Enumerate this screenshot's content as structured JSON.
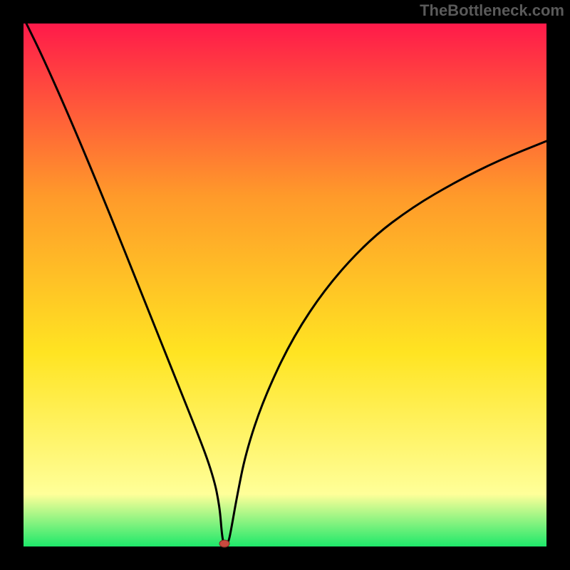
{
  "watermark": "TheBottleneck.com",
  "chart_data": {
    "type": "line",
    "title": "",
    "xlabel": "",
    "ylabel": "",
    "xlim": [
      33,
      767
    ],
    "ylim": [
      33,
      767
    ],
    "series": [
      {
        "name": "bottleneck-curve",
        "points": [
          [
            37,
            33
          ],
          [
            60,
            80
          ],
          [
            100,
            170
          ],
          [
            150,
            290
          ],
          [
            200,
            415
          ],
          [
            250,
            540
          ],
          [
            280,
            615
          ],
          [
            293,
            650
          ],
          [
            302,
            680
          ],
          [
            306,
            700
          ],
          [
            309,
            720
          ],
          [
            311,
            745
          ],
          [
            313,
            760
          ],
          [
            315,
            763
          ],
          [
            318,
            763
          ],
          [
            321,
            760
          ],
          [
            325,
            740
          ],
          [
            332,
            700
          ],
          [
            345,
            635
          ],
          [
            370,
            560
          ],
          [
            410,
            475
          ],
          [
            460,
            400
          ],
          [
            520,
            335
          ],
          [
            580,
            290
          ],
          [
            640,
            255
          ],
          [
            700,
            225
          ],
          [
            767,
            198
          ]
        ]
      }
    ],
    "marker": {
      "x": 315,
      "y": 763,
      "color": "#c94a3f"
    },
    "background_gradient": {
      "top": "#ff1a4a",
      "mid1": "#ff9a2a",
      "mid2": "#ffe422",
      "near_bottom": "#ffff99",
      "bottom": "#1ee86a"
    },
    "frame_color": "#000000"
  }
}
